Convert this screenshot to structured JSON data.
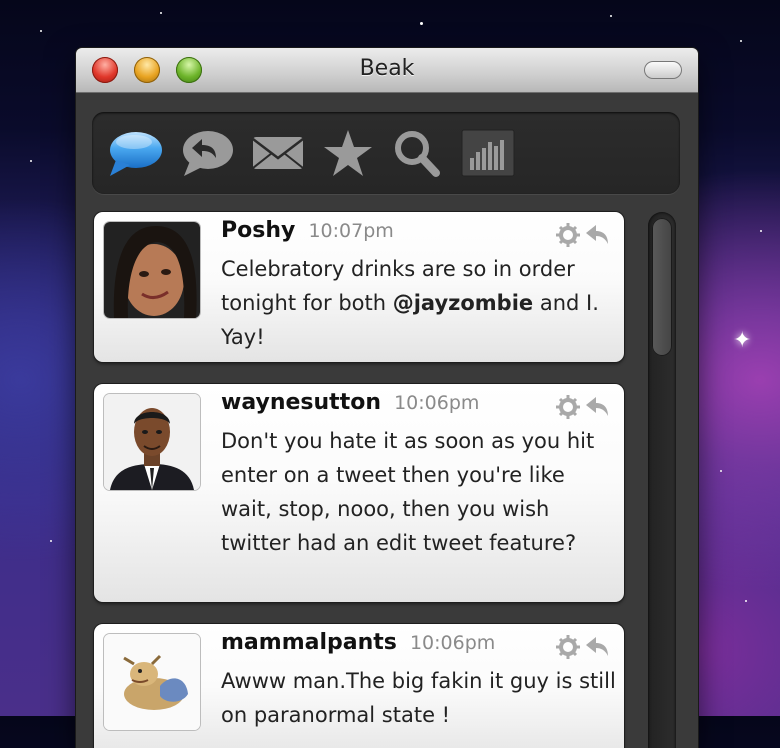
{
  "window": {
    "title": "Beak"
  },
  "toolbar": {
    "items": [
      {
        "icon": "speech-bubble-icon",
        "active": true
      },
      {
        "icon": "reply-bubble-icon",
        "active": false
      },
      {
        "icon": "mail-icon",
        "active": false
      },
      {
        "icon": "star-icon",
        "active": false
      },
      {
        "icon": "search-icon",
        "active": false
      },
      {
        "icon": "stats-icon",
        "active": false
      }
    ]
  },
  "tweets": [
    {
      "user": "Poshy",
      "time": "10:07pm",
      "text_before": "Celebratory drinks are so in order tonight for both ",
      "mention": "@jayzombie",
      "text_after": " and I. Yay!"
    },
    {
      "user": "waynesutton",
      "time": "10:06pm",
      "text": "Don't you hate it as soon as you hit enter on a tweet then you're like wait, stop, nooo, then you wish twitter had an edit tweet feature?"
    },
    {
      "user": "mammalpants",
      "time": "10:06pm",
      "text": "Awww man.The big fakin it guy is still on paranormal state !"
    }
  ],
  "colors": {
    "active_bubble": "#3fa2ee",
    "toolbar_icon": "#9a9a9a",
    "time_text": "#8a8a8a"
  }
}
